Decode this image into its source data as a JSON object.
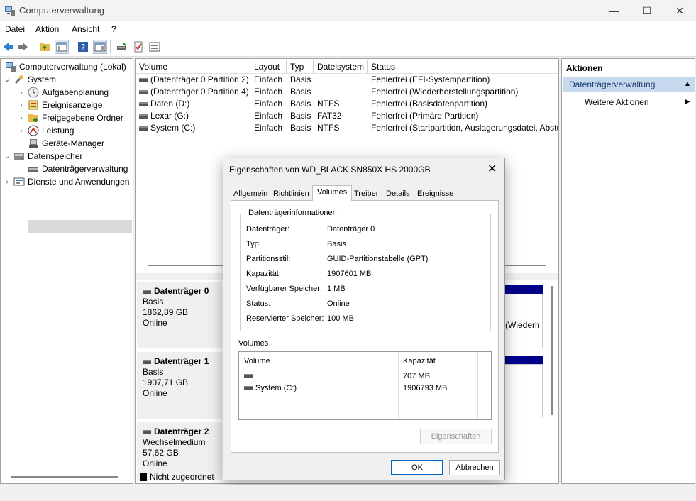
{
  "window": {
    "title": "Computerverwaltung",
    "controls": {
      "minimize": "—",
      "maximize": "☐",
      "close": "✕"
    }
  },
  "menu": [
    "Datei",
    "Aktion",
    "Ansicht",
    "?"
  ],
  "tree": {
    "root": "Computerverwaltung (Lokal)",
    "system": "System",
    "aufgaben": "Aufgabenplanung",
    "ereignis": "Ereignisanzeige",
    "freigabe": "Freigegebene Ordner",
    "leistung": "Leistung",
    "geraete": "Geräte-Manager",
    "speicher": "Datenspeicher",
    "dtv": "Datenträgerverwaltung",
    "dienste": "Dienste und Anwendungen"
  },
  "volumes": {
    "headers": [
      "Volume",
      "Layout",
      "Typ",
      "Dateisystem",
      "Status"
    ],
    "rows": [
      {
        "volume": "(Datenträger 0 Partition 2)",
        "layout": "Einfach",
        "typ": "Basis",
        "fs": "",
        "status": "Fehlerfrei (EFI-Systempartition)"
      },
      {
        "volume": "(Datenträger 0 Partition 4)",
        "layout": "Einfach",
        "typ": "Basis",
        "fs": "",
        "status": "Fehlerfrei (Wiederherstellungspartition)"
      },
      {
        "volume": "Daten (D:)",
        "layout": "Einfach",
        "typ": "Basis",
        "fs": "NTFS",
        "status": "Fehlerfrei (Basisdatenpartition)"
      },
      {
        "volume": "Lexar (G:)",
        "layout": "Einfach",
        "typ": "Basis",
        "fs": "FAT32",
        "status": "Fehlerfrei (Primäre Partition)"
      },
      {
        "volume": "System (C:)",
        "layout": "Einfach",
        "typ": "Basis",
        "fs": "NTFS",
        "status": "Fehlerfrei (Startpartition, Auslagerungsdatei, Absturzabbild"
      }
    ]
  },
  "disks": [
    {
      "name": "Datenträger 0",
      "type": "Basis",
      "size": "1862,89 GB",
      "state": "Online"
    },
    {
      "name": "Datenträger 1",
      "type": "Basis",
      "size": "1907,71 GB",
      "state": "Online"
    },
    {
      "name": "Datenträger 2",
      "type": "Wechselmedium",
      "size": "57,62 GB",
      "state": "Online"
    }
  ],
  "disk0_part_fragment": "(Wiederh",
  "legend_unassigned": "Nicht zugeordnet",
  "actions": {
    "header": "Aktionen",
    "section": "Datenträgerverwaltung",
    "more": "Weitere Aktionen"
  },
  "dialog": {
    "title": "Eigenschaften von WD_BLACK SN850X HS 2000GB",
    "tabs": [
      "Allgemein",
      "Richtlinien",
      "Volumes",
      "Treiber",
      "Details",
      "Ereignisse"
    ],
    "group_title": "Datenträgerinformationen",
    "info": [
      {
        "label": "Datenträger:",
        "value": "Datenträger 0"
      },
      {
        "label": "Typ:",
        "value": "Basis"
      },
      {
        "label": "Partitionsstil:",
        "value": "GUID-Partitionstabelle (GPT)"
      },
      {
        "label": "Kapazität:",
        "value": "1907601 MB"
      },
      {
        "label": "Verfügbarer Speicher:",
        "value": "1 MB"
      },
      {
        "label": "Status:",
        "value": "Online"
      },
      {
        "label": "Reservierter Speicher:",
        "value": "100 MB"
      }
    ],
    "volumes_label": "Volumes",
    "vol_headers": {
      "volume": "Volume",
      "cap": "Kapazität"
    },
    "vol_rows": [
      {
        "volume": "",
        "cap": "707 MB"
      },
      {
        "volume": "System (C:)",
        "cap": "1906793 MB"
      }
    ],
    "props_button": "Eigenschaften",
    "ok": "OK",
    "cancel": "Abbrechen"
  }
}
